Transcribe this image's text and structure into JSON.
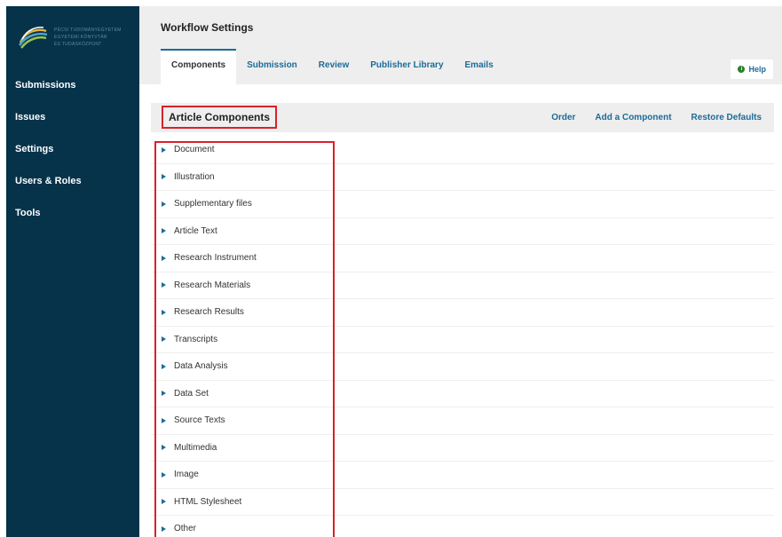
{
  "sidebar": {
    "logo_text": [
      "PÉCSI TUDOMÁNYEGYETEM",
      "EGYETEMI KÖNYVTÁR",
      "ÉS TUDÁSKÖZPONT"
    ],
    "items": [
      {
        "label": "Submissions"
      },
      {
        "label": "Issues"
      },
      {
        "label": "Settings"
      },
      {
        "label": "Users & Roles"
      },
      {
        "label": "Tools"
      }
    ]
  },
  "header": {
    "title": "Workflow Settings",
    "tabs": [
      {
        "label": "Components",
        "active": true
      },
      {
        "label": "Submission"
      },
      {
        "label": "Review"
      },
      {
        "label": "Publisher Library"
      },
      {
        "label": "Emails"
      }
    ],
    "help_label": "Help",
    "help_icon": "info-circle-icon"
  },
  "panel": {
    "title": "Article Components",
    "actions": [
      "Order",
      "Add a Component",
      "Restore Defaults"
    ],
    "items": [
      "Document",
      "Illustration",
      "Supplementary files",
      "Article Text",
      "Research Instrument",
      "Research Materials",
      "Research Results",
      "Transcripts",
      "Data Analysis",
      "Data Set",
      "Source Texts",
      "Multimedia",
      "Image",
      "HTML Stylesheet",
      "Other"
    ]
  },
  "colors": {
    "sidebar_bg": "#06324a",
    "link": "#1b6b99",
    "highlight": "#d8222a",
    "header_bg": "#eeeeee"
  }
}
